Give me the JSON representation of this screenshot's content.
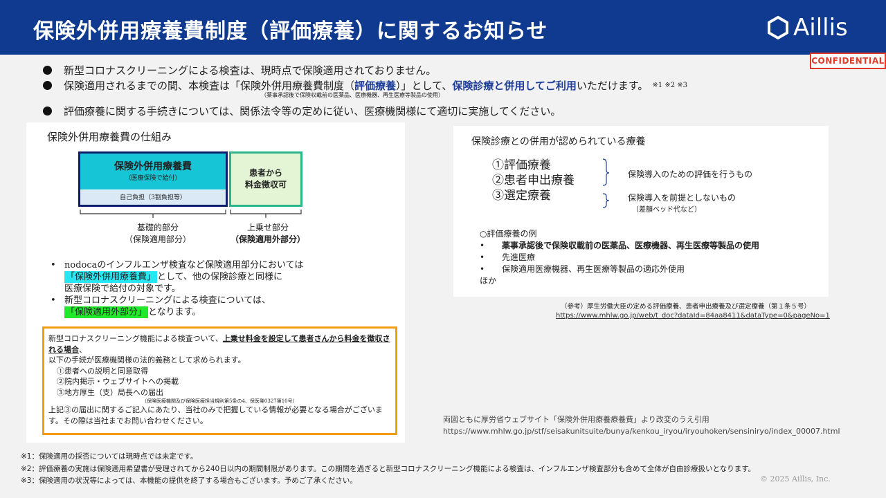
{
  "header": {
    "title": "保険外併用療養費制度（評価療養）に関するお知らせ",
    "logo_text": "Aillis"
  },
  "confidential": "CONFIDENTIAL",
  "bullets": {
    "b1": "新型コロナスクリーニングによる検査は、現時点で保険適用されておりません。",
    "b2_a": "保険適用されるまでの間、本検査は「保険外併用療養費制度（",
    "b2_hl1": "評価療養",
    "b2_b": "）」として、",
    "b2_hl2": "保険診療と併用してご利用",
    "b2_c": "いただけます。",
    "b2_refs": "※1 ※2 ※3",
    "b2_note": "（薬事承認後で保険収載前の医薬品、医療機器、再生医療等製品の使用）",
    "b3": "評価療養に関する手続きについては、関係法令等の定めに従い、医療機関様にて適切に実施してください。"
  },
  "left_panel": {
    "title": "保険外併用療養費の仕組み",
    "box_main_title": "保険外併用療養費",
    "box_main_sub": "（医療保険で給付）",
    "box_main_bottom": "自己負担（3割負担等）",
    "box_extra": [
      "患者から",
      "料金徴収可"
    ],
    "label_base": [
      "基礎的部分",
      "（保険適用部分）"
    ],
    "label_extra": [
      "上乗せ部分",
      "（保険適用外部分）"
    ],
    "list1_a": "nodocaのインフルエンザ検査など保険適用部分においては",
    "list1_mark": "「保険外併用療養費」",
    "list1_b": "として、他の保険診療と同様に",
    "list1_c": "医療保険で給付の対象です。",
    "list2_a": "新型コロナスクリーニングによる検査については、",
    "list2_mark": "「保険適用外部分」",
    "list2_b": "となります。",
    "orange": {
      "l1_a": "新型コロナスクリーニング機能による検査ついて、",
      "l1_ul": "上乗せ料金を設定して患者さんから料金を徴収される場合",
      "l1_b": "、",
      "l2": "以下の手続が医療機関様の法的義務として求められます。",
      "i1": "①患者への説明と同意取得",
      "i2": "②院内掲示・ウェブサイトへの掲載",
      "i3": "③地方厚生（支）局長への届出",
      "tiny": "（保険医療機関及び保険医療担当規則第5条の4、保医発0327第10号）",
      "l3": "上記③の届出に関するご記入にあたり、当社のみで把握している情報が必要となる場合がございます。その際は当社までお問い合わせください。"
    }
  },
  "right_panel": {
    "title": "保険診療との併用が認められている療養",
    "items": [
      "①評価療養",
      "②患者申出療養",
      "③選定療養"
    ],
    "desc1": "保険導入のための評価を行うもの",
    "desc2": "保険導入を前提としないもの",
    "desc2_paren": "（差額ベッド代など）",
    "ex_title": "○評価療養の例",
    "ex1": "薬事承認後で保険収載前の医薬品、医療機器、再生医療等製品の使用",
    "ex2": "先進医療",
    "ex3": "保険適用医療機器、再生医療等製品の適応外使用",
    "ex_other": "ほか"
  },
  "reference": {
    "note": "（参考）厚生労働大臣の定める評価療養、患者申出療養及び選定療養（第１条５号）",
    "url": "https://www.mhlw.go.jp/web/t_doc?dataId=84aa8411&dataType=0&pageNo=1"
  },
  "source": {
    "text": "両図ともに厚労省ウェブサイト「保険外併用療養療養費」より改変のうえ引用",
    "url": "https://www.mhlw.go.jp/stf/seisakunitsuite/bunya/kenkou_iryou/iryouhoken/sensiniryo/index_00007.html"
  },
  "footnotes": [
    "※1：保険適用の採否については現時点では未定です。",
    "※2：評価療養の実施は保険適用希望書が受理されてから240日以内の期間制限があります。この期間を過ぎると新型コロナスクリーニング機能による検査は、インフルエンザ検査部分も含めて全体が自由診療扱いとなります。",
    "※3：保険適用の状況等によっては、本機能の提供を終了する場合もございます。予めご了承ください。"
  ],
  "copyright": "© 2025 Aillis, Inc.",
  "colors": {
    "header_bg": "#0f3a8f",
    "accent_blue": "#1f3f99",
    "cyan": "#16c6d6",
    "green_border": "#2bb38a",
    "orange": "#f39c12",
    "confidential_red": "#e03a2a"
  }
}
